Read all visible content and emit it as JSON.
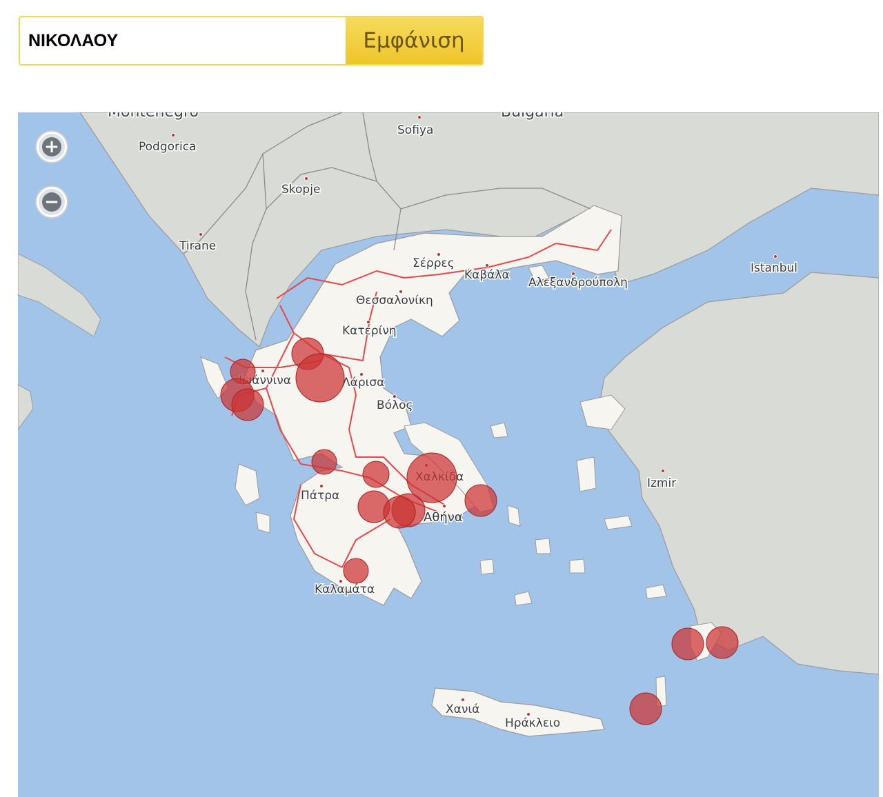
{
  "search": {
    "value": "ΝΙΚΟΛΑΟΥ",
    "button_label": "Εμφάνιση"
  },
  "map": {
    "zoom_in_label": "+",
    "zoom_out_label": "−",
    "labels": {
      "montenegro": "Montenegro",
      "bulgaria": "Bulgaria",
      "sofiya": "Sofiya",
      "podgorica": "Podgorica",
      "skopje": "Skopje",
      "tirane": "Tirane",
      "istanbul": "Istanbul",
      "serres": "Σέρρες",
      "kavala": "Καβάλα",
      "alexandroupoli": "Αλεξανδρούπολη",
      "thessaloniki": "Θεσσαλονίκη",
      "katerini": "Κατερίνη",
      "ioannina": "Ιωάννινα",
      "larisa": "Λάρισα",
      "volos": "Βόλος",
      "chalkida": "Χαλκίδα",
      "patra": "Πάτρα",
      "athina": "Αθήνα",
      "izmir": "Izmir",
      "kalamata": "Καλαμάτα",
      "chania": "Χανιά",
      "irakleio": "Ηράκλειο"
    }
  },
  "colors": {
    "sea": "#a3c4e9",
    "land_foreign": "#d9dbd6",
    "land_greece": "#f7f5f0",
    "road": "#e8474a",
    "marker": "#cc3333"
  }
}
